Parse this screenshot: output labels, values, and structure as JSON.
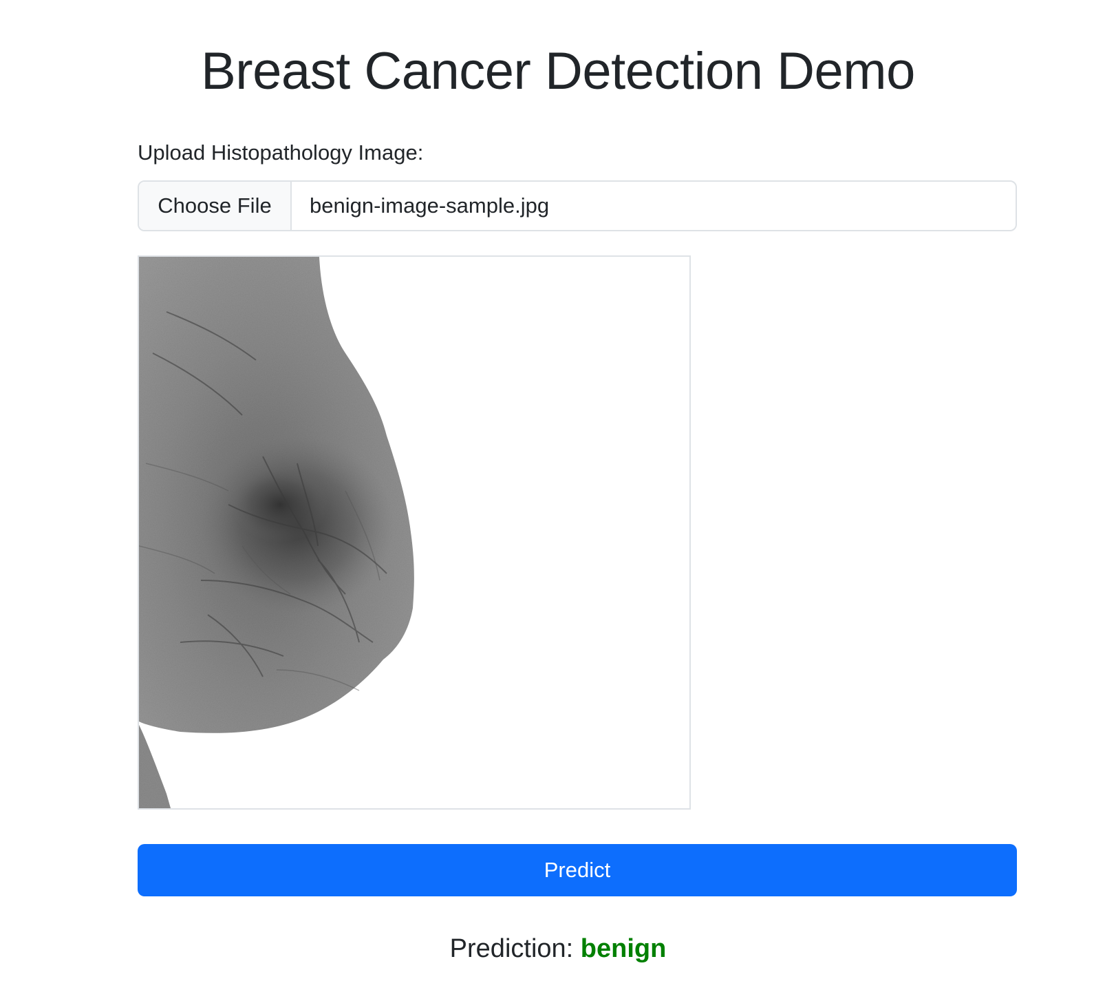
{
  "header": {
    "title": "Breast Cancer Detection Demo"
  },
  "upload": {
    "label": "Upload Histopathology Image:",
    "button_label": "Choose File",
    "file_name": "benign-image-sample.jpg"
  },
  "preview": {
    "icon": "mammogram-image"
  },
  "actions": {
    "predict_label": "Predict"
  },
  "prediction": {
    "prefix": "Prediction:",
    "result": "benign",
    "result_color": "#008000"
  },
  "colors": {
    "primary": "#0d6efd",
    "text": "#212529",
    "border": "#dee2e6"
  }
}
